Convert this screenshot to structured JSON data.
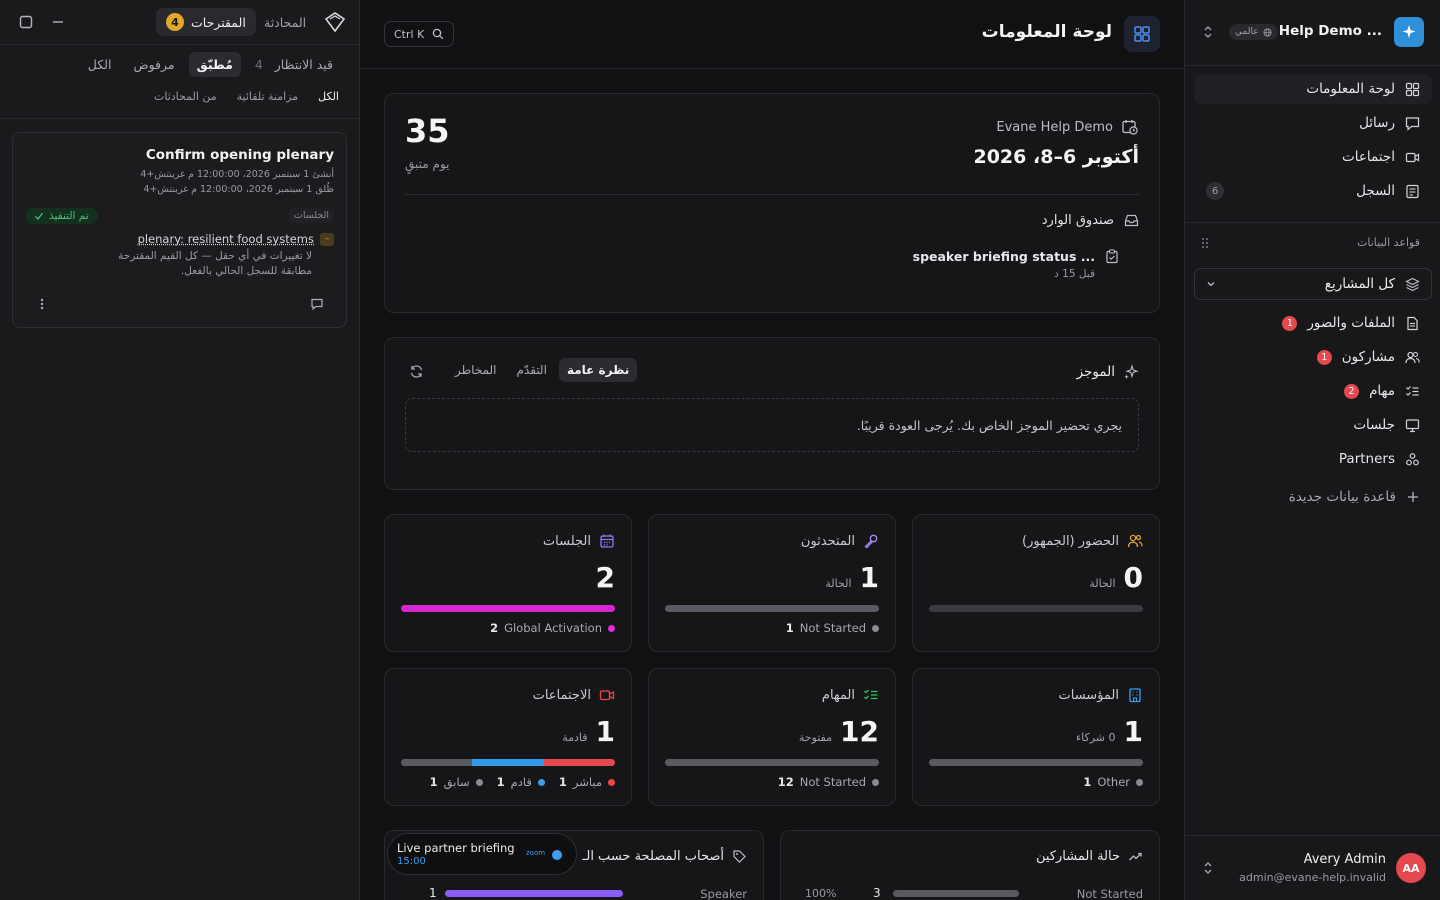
{
  "left_panel": {
    "tabs": {
      "conversation": "المحادثة",
      "suggestions": "المقترحات",
      "suggestions_count": "4"
    },
    "status_filters": {
      "pending": "قيد الانتظار",
      "pending_count": "4",
      "applied": "مُطبّق",
      "rejected": "مرفوض",
      "all": "الكل"
    },
    "source_filters": {
      "all": "الكل",
      "auto_sync": "مزامنة تلقائية",
      "from_conversations": "من المحادثات"
    },
    "suggestion": {
      "title": "Confirm opening plenary",
      "created": "أنشئ 1 سبتمبر 2026، 12:00:00 م غرينتش+4",
      "closed": "ظُلق 1 سبتمبر 2026، 12:00:00 م غرينتش+4",
      "table_tag": "الجلسات",
      "status": "تم التنفيذ",
      "record_link": "plenary: resilient food systems",
      "note1": "لا تغييرات في أي حقل — كل القيم المقترحة",
      "note2": "مطابقة للسجل الحالي بالفعل."
    }
  },
  "main": {
    "page_title": "لوحة المعلومات",
    "search_shortcut": "Ctrl K",
    "event": {
      "name": "Evane Help Demo",
      "dates": "أكتوبر 6–8، 2026",
      "days_left": "35",
      "days_left_label": "يوم متبقٍ"
    },
    "inbox": {
      "title": "صندوق الوارد",
      "item_title": "speaker briefing status ...",
      "item_time": "قبل 15 د"
    },
    "brief": {
      "title": "الموجز",
      "tabs": [
        "نظرة عامة",
        "التقدّم",
        "المخاطر"
      ],
      "message": "يجري تحضير الموجز الخاص بك. يُرجى العودة قريبًا."
    },
    "stats": [
      {
        "title": "الحضور (الجمهور)",
        "value": "0",
        "sub": "الحالة",
        "color": "#e0a82e",
        "legend": [],
        "fill": []
      },
      {
        "title": "المتحدثون",
        "value": "1",
        "sub": "الحالة",
        "color": "#a78bfa",
        "legend": [
          {
            "count": "1",
            "label": "Not Started",
            "color": "#8b8b93"
          }
        ],
        "fill": [
          {
            "pct": 100,
            "color": "#5a5a62"
          }
        ]
      },
      {
        "title": "الجلسات",
        "value": "2",
        "sub": "",
        "color": "#8b7cf6",
        "legend": [
          {
            "count": "2",
            "label": "Global Activation",
            "color": "#e22bd8"
          }
        ],
        "fill": [
          {
            "pct": 100,
            "color": "#d526d0"
          }
        ]
      },
      {
        "title": "المؤسسات",
        "value": "1",
        "sub": "0 شركاء",
        "color": "#3b9ef0",
        "legend": [
          {
            "count": "1",
            "label": "Other",
            "color": "#8b8b93"
          }
        ],
        "fill": [
          {
            "pct": 100,
            "color": "#5a5a62"
          }
        ]
      },
      {
        "title": "المهام",
        "value": "12",
        "sub": "مفتوحة",
        "color": "#22c55e",
        "legend": [
          {
            "count": "12",
            "label": "Not Started",
            "color": "#8b8b93"
          }
        ],
        "fill": [
          {
            "pct": 100,
            "color": "#5a5a62"
          }
        ]
      },
      {
        "title": "الاجتماعات",
        "value": "1",
        "sub": "قادمة",
        "color": "#ef4444",
        "legend": [
          {
            "count": "1",
            "label": "مباشر",
            "color": "#ef4444"
          },
          {
            "count": "1",
            "label": "قادم",
            "color": "#3b9ef0"
          },
          {
            "count": "1",
            "label": "سابق",
            "color": "#8b8b93"
          }
        ],
        "fill": [
          {
            "pct": 33.3,
            "color": "#5a5a62"
          },
          {
            "pct": 33.3,
            "color": "#2f9be8"
          },
          {
            "pct": 33.4,
            "color": "#e5484d"
          }
        ]
      }
    ],
    "stakeholders": {
      "title": "أصحاب المصلحة حسب الـ",
      "row_label": "Speaker",
      "row_count": "1",
      "row_pct": 100
    },
    "participants": {
      "title": "حالة المشاركين",
      "row_label": "Not Started",
      "row_count": "3",
      "row_pct_text": "100%",
      "row_pct": 100
    },
    "live_toast": {
      "title": "Live partner briefing",
      "time": "15:00",
      "provider": "zoom"
    }
  },
  "sidebar": {
    "workspace": "Help Demo ...",
    "scope": "عالمي",
    "nav": [
      {
        "label": "لوحة المعلومات",
        "icon": "dashboard-icon"
      },
      {
        "label": "رسائل",
        "icon": "message-icon"
      },
      {
        "label": "اجتماعات",
        "icon": "video-icon"
      },
      {
        "label": "السجل",
        "icon": "log-icon",
        "badge": "6"
      }
    ],
    "databases_label": "قواعد البيانات",
    "project_selector": "كل المشاريع",
    "db_items": [
      {
        "label": "الملفات والصور",
        "icon": "file-icon",
        "badge": "1"
      },
      {
        "label": "مشاركون",
        "icon": "users-icon",
        "badge": "1"
      },
      {
        "label": "مهام",
        "icon": "checklist-icon",
        "badge": "2"
      },
      {
        "label": "جلسات",
        "icon": "presentation-icon"
      },
      {
        "label": "Partners",
        "icon": "partners-icon"
      }
    ],
    "new_database": "قاعدة بيانات جديدة",
    "user": {
      "name": "Avery Admin",
      "email": "admin@evane-help.invalid",
      "initials": "AA",
      "avatar_color": "#e5484d"
    }
  }
}
